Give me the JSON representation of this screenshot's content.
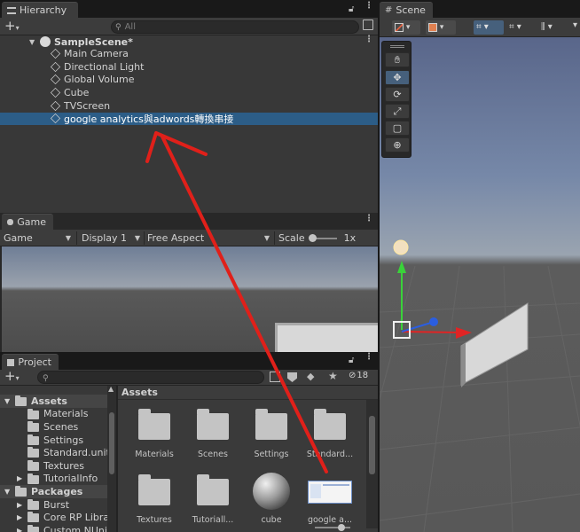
{
  "hierarchy": {
    "tab_title": "Hierarchy",
    "search_placeholder": "All",
    "scene_name": "SampleScene*",
    "items": [
      {
        "label": "Main Camera"
      },
      {
        "label": "Directional Light"
      },
      {
        "label": "Global Volume"
      },
      {
        "label": "Cube"
      },
      {
        "label": "TVScreen"
      },
      {
        "label": "google analytics與adwords轉換串接",
        "selected": true
      }
    ]
  },
  "scene": {
    "tab_title": "Scene"
  },
  "game": {
    "tab_title": "Game",
    "view_mode": "Game",
    "display": "Display 1",
    "aspect": "Free Aspect",
    "scale_label": "Scale",
    "scale_value": "1x"
  },
  "project": {
    "tab_title": "Project",
    "count": "18",
    "tree": [
      {
        "label": "Assets",
        "level": 0,
        "expanded": true,
        "bold": true
      },
      {
        "label": "Materials",
        "level": 1
      },
      {
        "label": "Scenes",
        "level": 1
      },
      {
        "label": "Settings",
        "level": 1
      },
      {
        "label": "Standard.unity",
        "level": 1
      },
      {
        "label": "Textures",
        "level": 1
      },
      {
        "label": "TutorialInfo",
        "level": 1,
        "collapsed": true
      },
      {
        "label": "Packages",
        "level": 0,
        "expanded": true,
        "bold": true
      },
      {
        "label": "Burst",
        "level": 1,
        "collapsed": true
      },
      {
        "label": "Core RP Librar",
        "level": 1,
        "collapsed": true
      },
      {
        "label": "Custom NUnit",
        "level": 1,
        "collapsed": true
      }
    ],
    "breadcrumb": "Assets",
    "assets": [
      {
        "label": "Materials",
        "kind": "folder"
      },
      {
        "label": "Scenes",
        "kind": "folder"
      },
      {
        "label": "Settings",
        "kind": "folder"
      },
      {
        "label": "Standard...",
        "kind": "folder"
      },
      {
        "label": "Textures",
        "kind": "folder"
      },
      {
        "label": "Tutoriall...",
        "kind": "folder"
      },
      {
        "label": "cube",
        "kind": "material"
      },
      {
        "label": "google a...",
        "kind": "texture"
      }
    ]
  },
  "colors": {
    "selection": "#2c5d87",
    "annotation_arrow": "#e0201a",
    "panel_bg": "#383838"
  }
}
